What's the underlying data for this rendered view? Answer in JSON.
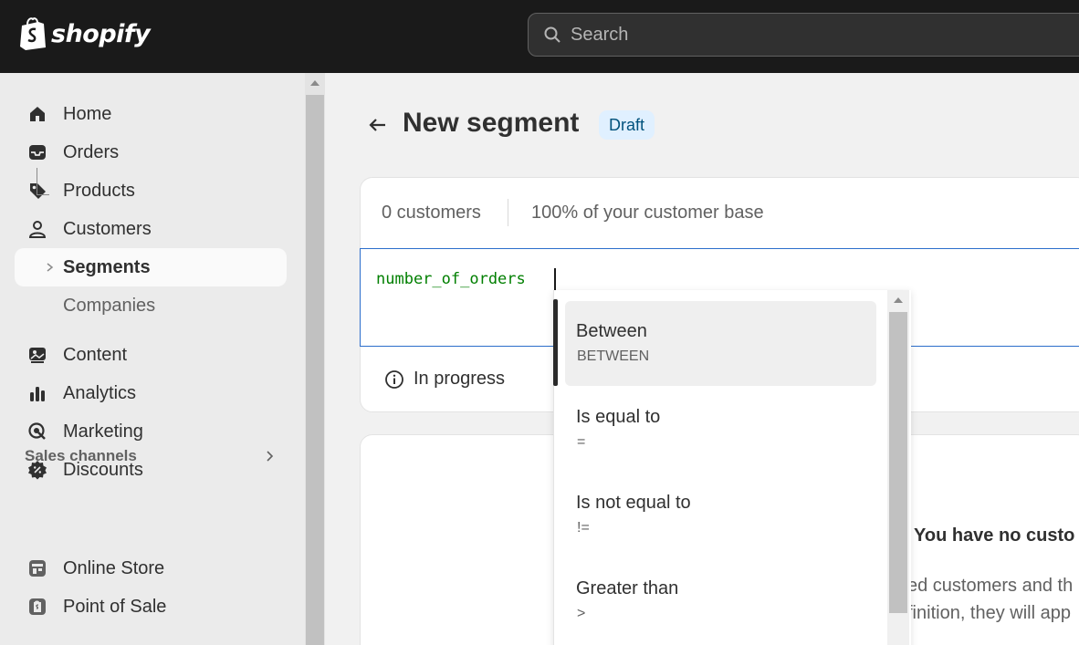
{
  "brand": {
    "name": "shopify"
  },
  "search": {
    "placeholder": "Search"
  },
  "sidebar": {
    "items": [
      {
        "label": "Home",
        "icon": "home-icon"
      },
      {
        "label": "Orders",
        "icon": "inbox-icon"
      },
      {
        "label": "Products",
        "icon": "tag-icon"
      },
      {
        "label": "Customers",
        "icon": "person-icon"
      },
      {
        "label": "Segments",
        "active": true
      },
      {
        "label": "Companies"
      },
      {
        "label": "Content",
        "icon": "image-icon"
      },
      {
        "label": "Analytics",
        "icon": "bar-chart-icon"
      },
      {
        "label": "Marketing",
        "icon": "target-icon"
      },
      {
        "label": "Discounts",
        "icon": "discount-icon"
      }
    ],
    "section_title": "Sales channels",
    "channels": [
      {
        "label": "Online Store",
        "icon": "store-icon"
      },
      {
        "label": "Point of Sale",
        "icon": "pos-icon"
      }
    ]
  },
  "page": {
    "title": "New segment",
    "status_badge": "Draft"
  },
  "segment": {
    "customer_count": "0 customers",
    "base_share": "100% of your customer base",
    "query": "number_of_orders",
    "status": "In progress"
  },
  "autocomplete": {
    "options": [
      {
        "label": "Between",
        "operator": "BETWEEN",
        "selected": true
      },
      {
        "label": "Is equal to",
        "operator": "="
      },
      {
        "label": "Is not equal to",
        "operator": "!="
      },
      {
        "label": "Greater than",
        "operator": ">"
      }
    ]
  },
  "empty_state": {
    "title": "You have no custo",
    "line1": "ed customers and th",
    "line2": "finition, they will app"
  },
  "colors": {
    "topbar": "#1a1a1a",
    "badge_bg": "#e0f0ff",
    "badge_text": "#00527c",
    "code_green": "#007f00",
    "editor_border": "#2c6ecb"
  }
}
